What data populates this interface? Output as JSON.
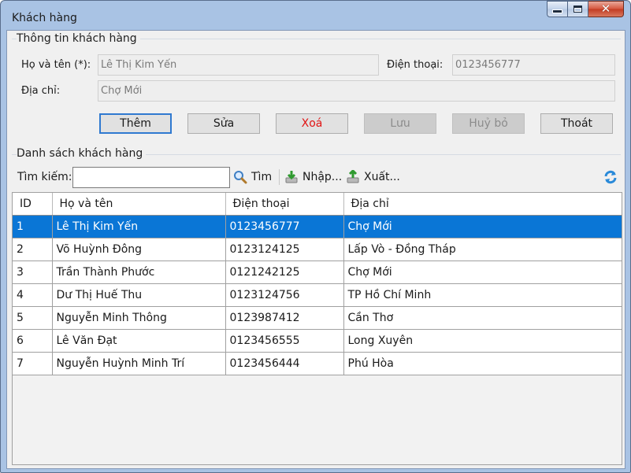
{
  "window": {
    "title": "Khách hàng"
  },
  "info": {
    "group_title": "Thông tin khách hàng",
    "name_label": "Họ và tên (*):",
    "name_value": "Lê Thị Kim Yến",
    "phone_label": "Điện thoại:",
    "phone_value": "0123456777",
    "address_label": "Địa chỉ:",
    "address_value": "Chợ Mới"
  },
  "buttons": {
    "add": "Thêm",
    "edit": "Sửa",
    "delete": "Xoá",
    "save": "Lưu",
    "cancel": "Huỷ bỏ",
    "exit": "Thoát"
  },
  "list": {
    "group_title": "Danh sách khách hàng",
    "search_label": "Tìm kiếm:",
    "search_value": "",
    "find_label": "Tìm",
    "import_label": "Nhập...",
    "export_label": "Xuất..."
  },
  "table": {
    "columns": [
      "ID",
      "Họ và tên",
      "Điện thoại",
      "Địa chỉ"
    ],
    "rows": [
      [
        "1",
        "Lê Thị Kim Yến",
        "0123456777",
        "Chợ Mới"
      ],
      [
        "2",
        "Võ Huỳnh Đông",
        "0123124125",
        "Lấp Vò - Đồng Tháp"
      ],
      [
        "3",
        "Trần Thành Phước",
        "0121242125",
        "Chợ Mới"
      ],
      [
        "4",
        "Dư Thị Huế Thu",
        "0123124756",
        "TP Hồ Chí Minh"
      ],
      [
        "5",
        "Nguyễn Minh Thông",
        "0123987412",
        "Cần Thơ"
      ],
      [
        "6",
        "Lê Văn Đạt",
        "0123456555",
        "Long Xuyên"
      ],
      [
        "7",
        "Nguyễn Huỳnh Minh Trí",
        "0123456444",
        "Phú Hòa"
      ]
    ]
  },
  "colors": {
    "selection": "#0a76d6",
    "danger_text": "#e11414",
    "titlebar": "#a9c3e4",
    "close_button": "#c23b22"
  },
  "icons": [
    "minimize-icon",
    "maximize-icon",
    "close-icon",
    "search-icon",
    "import-icon",
    "export-icon",
    "refresh-icon"
  ]
}
